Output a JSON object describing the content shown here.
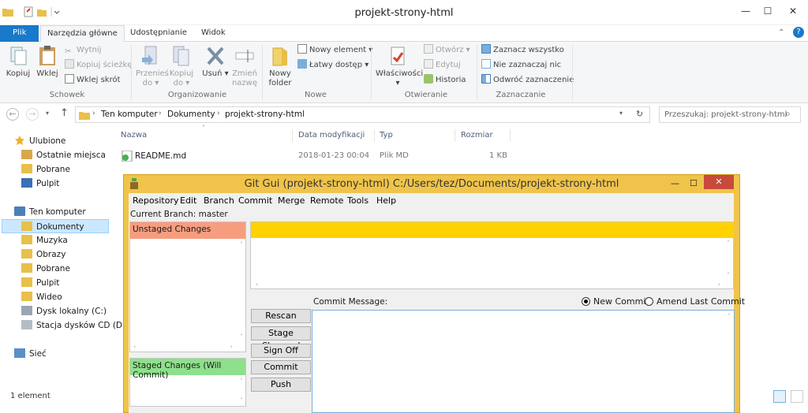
{
  "window": {
    "title": "projekt-strony-html",
    "minimize": "—",
    "maximize": "☐",
    "close": "✕"
  },
  "ribbon_tabs": [
    "Plik",
    "Narzędzia główne",
    "Udostępnianie",
    "Widok"
  ],
  "ribbon": {
    "clipboard": {
      "copy": "Kopiuj",
      "paste": "Wklej",
      "cut": "Wytnij",
      "copy_path": "Kopiuj ścieżkę",
      "paste_shortcut": "Wklej skrót",
      "label": "Schowek"
    },
    "organize": {
      "move_to": [
        "Przenieś",
        "do"
      ],
      "copy_to": [
        "Kopiuj",
        "do"
      ],
      "delete": "Usuń",
      "rename": [
        "Zmień",
        "nazwę"
      ],
      "label": "Organizowanie"
    },
    "new": {
      "new_folder": [
        "Nowy",
        "folder"
      ],
      "new_item": "Nowy element",
      "easy_access": "Łatwy dostęp",
      "label": "Nowe"
    },
    "open": {
      "properties": "Właściwości",
      "open": "Otwórz",
      "edit": "Edytuj",
      "history": "Historia",
      "label": "Otwieranie"
    },
    "select": {
      "select_all": "Zaznacz wszystko",
      "select_none": "Nie zaznaczaj nic",
      "invert": "Odwróć zaznaczenie",
      "label": "Zaznaczanie"
    }
  },
  "address": {
    "crumbs": [
      "Ten komputer",
      "Dokumenty",
      "projekt-strony-html"
    ],
    "search_placeholder": "Przeszukaj: projekt-strony-html"
  },
  "tree": {
    "favorites": "Ulubione",
    "fav_items": [
      "Ostatnie miejsca",
      "Pobrane",
      "Pulpit"
    ],
    "computer": "Ten komputer",
    "comp_items": [
      "Dokumenty",
      "Muzyka",
      "Obrazy",
      "Pobrane",
      "Pulpit",
      "Wideo",
      "Dysk lokalny (C:)",
      "Stacja dysków CD (D"
    ],
    "network": "Sieć"
  },
  "columns": [
    "Nazwa",
    "Data modyfikacji",
    "Typ",
    "Rozmiar"
  ],
  "files": [
    {
      "name": "README.md",
      "date": "2018-01-23 00:04",
      "type": "Plik MD",
      "size": "1 KB"
    }
  ],
  "status": "1 element",
  "git": {
    "title": "Git Gui (projekt-strony-html) C:/Users/tez/Documents/projekt-strony-html",
    "menu": [
      "Repository",
      "Edit",
      "Branch",
      "Commit",
      "Merge",
      "Remote",
      "Tools",
      "Help"
    ],
    "current_branch": "Current Branch: master",
    "unstaged": "Unstaged Changes",
    "staged": "Staged Changes (Will Commit)",
    "commit_message": "Commit Message:",
    "new_commit": "New Commit",
    "amend": "Amend Last Commit",
    "buttons": [
      "Rescan",
      "Stage Changed",
      "Sign Off",
      "Commit",
      "Push"
    ],
    "colors": {
      "unstaged": "#f79d7f",
      "staged": "#8ee08c",
      "diff_header": "#ffd200",
      "frame": "#f0c44a"
    }
  }
}
